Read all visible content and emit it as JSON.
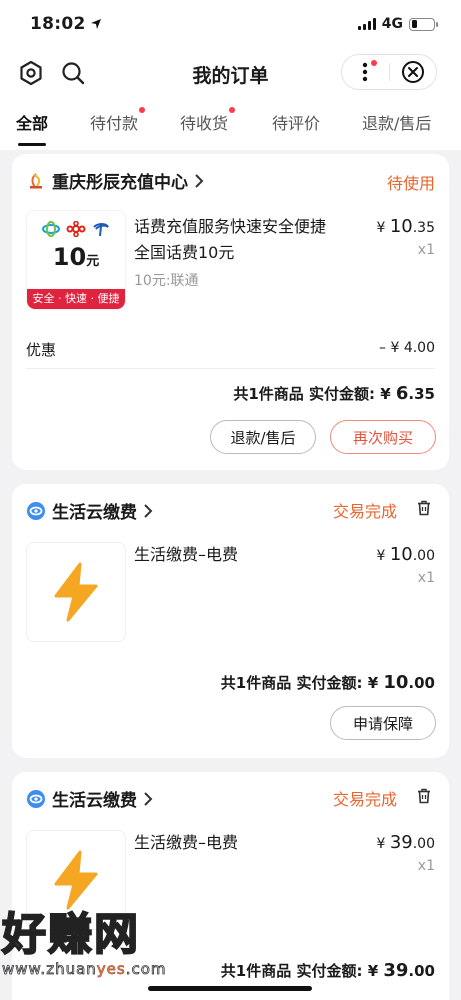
{
  "status_bar": {
    "time": "18:02",
    "network": "4G"
  },
  "nav": {
    "title": "我的订单"
  },
  "tabs": [
    {
      "label": "全部",
      "active": true,
      "dot": false
    },
    {
      "label": "待付款",
      "active": false,
      "dot": true
    },
    {
      "label": "待收货",
      "active": false,
      "dot": true
    },
    {
      "label": "待评价",
      "active": false,
      "dot": false
    },
    {
      "label": "退款/售后",
      "active": false,
      "dot": false
    }
  ],
  "orders": [
    {
      "shop": "重庆彤辰充值中心",
      "status": "待使用",
      "thumb": {
        "amount": "10",
        "unit": "元",
        "banner": "安全 · 快速 · 便捷"
      },
      "title_line1": "话费充值服务快速安全便捷",
      "title_line2": "全国话费10元",
      "spec": "10元:联通",
      "price_symbol": "¥",
      "price_int": "10",
      "price_dec": ".35",
      "qty": "x1",
      "discount_label": "优惠",
      "discount_value": "– ¥ 4.00",
      "total_label": "共1件商品  实付金额: ",
      "total_symbol": "¥",
      "total_int": "6",
      "total_dec": ".35",
      "buttons": [
        "退款/售后",
        "再次购买"
      ]
    },
    {
      "shop": "生活云缴费",
      "status": "交易完成",
      "title_line1": "生活缴费–电费",
      "price_symbol": "¥",
      "price_int": "10",
      "price_dec": ".00",
      "qty": "x1",
      "total_label": "共1件商品  实付金额: ",
      "total_symbol": "¥",
      "total_int": "10",
      "total_dec": ".00",
      "buttons": [
        "申请保障"
      ]
    },
    {
      "shop": "生活云缴费",
      "status": "交易完成",
      "title_line1": "生活缴费–电费",
      "price_symbol": "¥",
      "price_int": "39",
      "price_dec": ".00",
      "qty": "x1",
      "total_label": "共1件商品  实付金额: ",
      "total_symbol": "¥",
      "total_int": "39",
      "total_dec": ".00"
    }
  ],
  "watermark": {
    "logo_text": "好赚网",
    "url_prefix": "www.zhuan",
    "url_highlight": "yes",
    "url_suffix": ".com"
  },
  "colors": {
    "accent": "#e8672e",
    "red_btn": "#e8533d",
    "bolt": "#f5a623"
  }
}
